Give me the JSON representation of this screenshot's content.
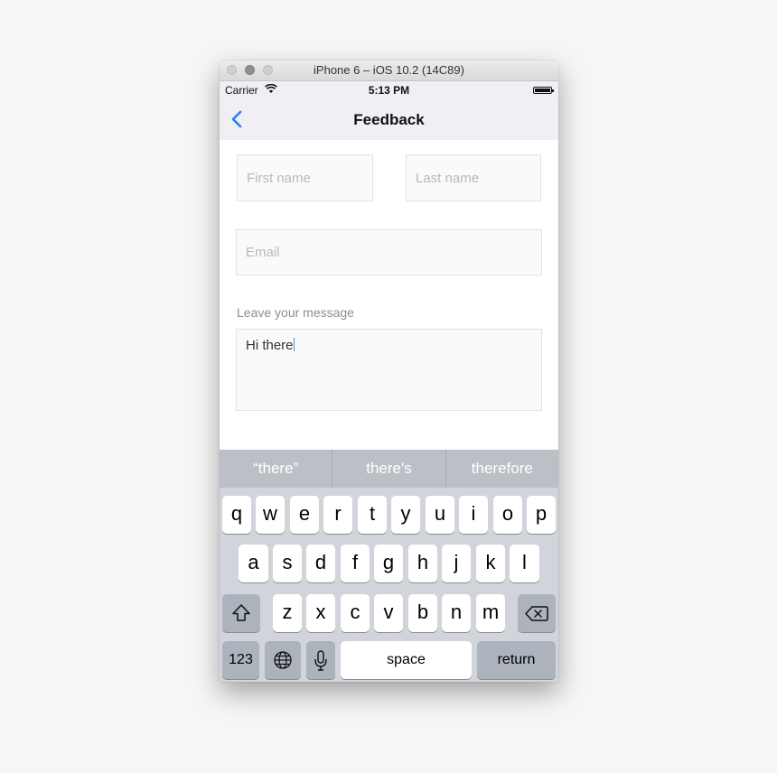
{
  "window": {
    "title": "iPhone 6 – iOS 10.2 (14C89)"
  },
  "statusbar": {
    "carrier": "Carrier",
    "time": "5:13 PM"
  },
  "nav": {
    "title": "Feedback"
  },
  "form": {
    "first_name_placeholder": "First name",
    "last_name_placeholder": "Last name",
    "email_placeholder": "Email",
    "message_label": "Leave your message",
    "message_value": "Hi there"
  },
  "keyboard": {
    "predictions": [
      "“there”",
      "there's",
      "therefore"
    ],
    "row1": [
      "q",
      "w",
      "e",
      "r",
      "t",
      "y",
      "u",
      "i",
      "o",
      "p"
    ],
    "row2": [
      "a",
      "s",
      "d",
      "f",
      "g",
      "h",
      "j",
      "k",
      "l"
    ],
    "row3": [
      "z",
      "x",
      "c",
      "v",
      "b",
      "n",
      "m"
    ],
    "numbers_label": "123",
    "space_label": "space",
    "return_label": "return",
    "icons": [
      "shift-icon",
      "delete-icon",
      "globe-icon",
      "microphone-icon"
    ]
  },
  "colors": {
    "accent": "#2d7cf6",
    "keyboard_bg": "#d1d5db",
    "nav_bg": "#efeff4"
  }
}
